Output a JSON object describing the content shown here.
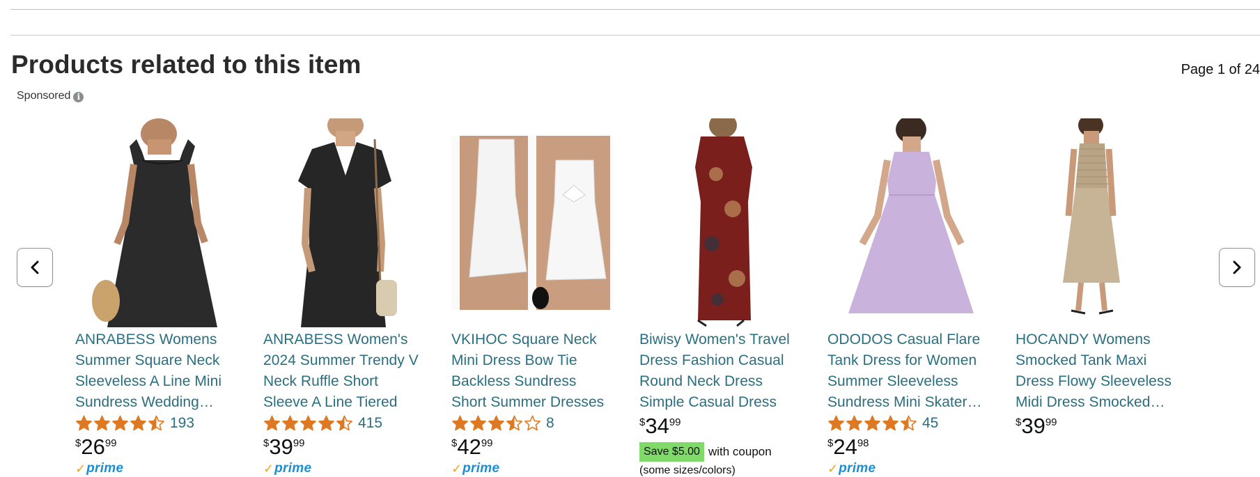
{
  "section": {
    "title": "Products related to this item",
    "page_indicator": "Page 1 of 24",
    "sponsored_label": "Sponsored",
    "info_icon": "info-icon"
  },
  "nav": {
    "prev_icon": "chevron-left-icon",
    "next_icon": "chevron-right-icon"
  },
  "colors": {
    "link": "#2a6f80",
    "star": "#de7921",
    "prime_check": "#f0a41d",
    "prime_word": "#1e8ed1",
    "coupon_badge": "#7fda69"
  },
  "products": [
    {
      "title": "ANRABESS Womens Summer Square Neck Sleeveless A Line Mini Sundress Wedding…",
      "rating": 4.5,
      "rating_count": "193",
      "price": {
        "symbol": "$",
        "whole": "26",
        "fraction": "99"
      },
      "prime": true
    },
    {
      "title": "ANRABESS Women's 2024 Summer Trendy V Neck Ruffle Short Sleeve A Line Tiered Flowy ...",
      "rating": 4.5,
      "rating_count": "415",
      "price": {
        "symbol": "$",
        "whole": "39",
        "fraction": "99"
      },
      "prime": true
    },
    {
      "title": "VKIHOC Square Neck Mini Dress Bow Tie Backless Sundress Short Summer Dresses for…",
      "rating": 3.5,
      "rating_count": "8",
      "price": {
        "symbol": "$",
        "whole": "42",
        "fraction": "99"
      },
      "prime": true
    },
    {
      "title": "Biwisy Women's Travel Dress Fashion Casual Round Neck Dress Simple Casual Dress",
      "price": {
        "symbol": "$",
        "whole": "34",
        "fraction": "99"
      },
      "coupon": {
        "badge": "Save $5.00",
        "suffix": "with coupon",
        "note": "(some sizes/colors)"
      }
    },
    {
      "title": "ODODOS Casual Flare Tank Dress for Women Summer Sleeveless Sundress Mini Skater…",
      "rating": 4.5,
      "rating_count": "45",
      "price": {
        "symbol": "$",
        "whole": "24",
        "fraction": "98"
      },
      "prime": true
    },
    {
      "title": "HOCANDY Womens Smocked Tank Maxi Dress Flowy Sleeveless Midi Dress Smocked…",
      "price": {
        "symbol": "$",
        "whole": "39",
        "fraction": "99"
      }
    }
  ],
  "prime_label": "prime"
}
